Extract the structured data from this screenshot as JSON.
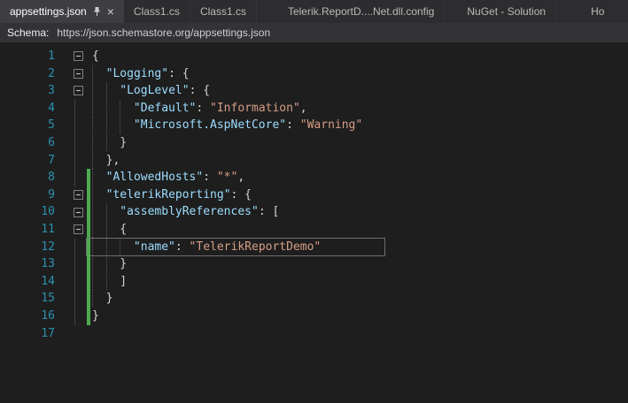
{
  "icons": {
    "close": "×"
  },
  "tabs": [
    {
      "label": "appsettings.json",
      "active": true,
      "pinned": true
    },
    {
      "label": "Class1.cs",
      "active": false
    },
    {
      "label": "Class1.cs",
      "active": false
    },
    {
      "label": "Telerik.ReportD....Net.dll.config",
      "active": false
    },
    {
      "label": "NuGet - Solution",
      "active": false
    },
    {
      "label": "Ho",
      "active": false
    }
  ],
  "schema_bar": {
    "label": "Schema:",
    "value": "https://json.schemastore.org/appsettings.json"
  },
  "editor": {
    "colors": {
      "key": "#9cdcfe",
      "string": "#d69d85",
      "punct": "#d4d4d4",
      "line_number": "#2b91af",
      "changed_bar": "#4dab4d"
    },
    "lines": [
      {
        "n": "1",
        "indent": 0,
        "fold": "box",
        "changed": false,
        "current": false,
        "tokens": [
          [
            "p",
            "{"
          ]
        ]
      },
      {
        "n": "2",
        "indent": 1,
        "fold": "box",
        "changed": false,
        "current": false,
        "tokens": [
          [
            "k",
            "\"Logging\""
          ],
          [
            "p",
            ": {"
          ]
        ]
      },
      {
        "n": "3",
        "indent": 2,
        "fold": "box",
        "changed": false,
        "current": false,
        "tokens": [
          [
            "k",
            "\"LogLevel\""
          ],
          [
            "p",
            ": {"
          ]
        ]
      },
      {
        "n": "4",
        "indent": 3,
        "fold": "line",
        "changed": false,
        "current": false,
        "tokens": [
          [
            "k",
            "\"Default\""
          ],
          [
            "p",
            ": "
          ],
          [
            "s",
            "\"Information\""
          ],
          [
            "p",
            ","
          ]
        ]
      },
      {
        "n": "5",
        "indent": 3,
        "fold": "line",
        "changed": false,
        "current": false,
        "tokens": [
          [
            "k",
            "\"Microsoft.AspNetCore\""
          ],
          [
            "p",
            ": "
          ],
          [
            "s",
            "\"Warning\""
          ]
        ]
      },
      {
        "n": "6",
        "indent": 2,
        "fold": "line",
        "changed": false,
        "current": false,
        "tokens": [
          [
            "p",
            "}"
          ]
        ]
      },
      {
        "n": "7",
        "indent": 1,
        "fold": "line",
        "changed": false,
        "current": false,
        "tokens": [
          [
            "p",
            "},"
          ]
        ]
      },
      {
        "n": "8",
        "indent": 1,
        "fold": "line",
        "changed": true,
        "current": false,
        "tokens": [
          [
            "k",
            "\"AllowedHosts\""
          ],
          [
            "p",
            ": "
          ],
          [
            "s",
            "\"*\""
          ],
          [
            "p",
            ","
          ]
        ]
      },
      {
        "n": "9",
        "indent": 1,
        "fold": "box",
        "changed": true,
        "current": false,
        "tokens": [
          [
            "k",
            "\"telerikReporting\""
          ],
          [
            "p",
            ": {"
          ]
        ]
      },
      {
        "n": "10",
        "indent": 2,
        "fold": "box",
        "changed": true,
        "current": false,
        "tokens": [
          [
            "k",
            "\"assemblyReferences\""
          ],
          [
            "p",
            ": ["
          ]
        ]
      },
      {
        "n": "11",
        "indent": 2,
        "fold": "box",
        "changed": true,
        "current": false,
        "tokens": [
          [
            "p",
            "{"
          ]
        ]
      },
      {
        "n": "12",
        "indent": 3,
        "fold": "line",
        "changed": true,
        "current": true,
        "tokens": [
          [
            "k",
            "\"name\""
          ],
          [
            "p",
            ": "
          ],
          [
            "s",
            "\"TelerikReportDemo\""
          ]
        ]
      },
      {
        "n": "13",
        "indent": 2,
        "fold": "line",
        "changed": true,
        "current": false,
        "tokens": [
          [
            "p",
            "}"
          ]
        ]
      },
      {
        "n": "14",
        "indent": 2,
        "fold": "line",
        "changed": true,
        "current": false,
        "tokens": [
          [
            "p",
            "]"
          ]
        ]
      },
      {
        "n": "15",
        "indent": 1,
        "fold": "line",
        "changed": true,
        "current": false,
        "tokens": [
          [
            "p",
            "}"
          ]
        ]
      },
      {
        "n": "16",
        "indent": 0,
        "fold": "line",
        "changed": true,
        "current": false,
        "tokens": [
          [
            "p",
            "}"
          ]
        ]
      },
      {
        "n": "17",
        "indent": 0,
        "fold": "",
        "changed": false,
        "current": false,
        "tokens": []
      }
    ]
  }
}
